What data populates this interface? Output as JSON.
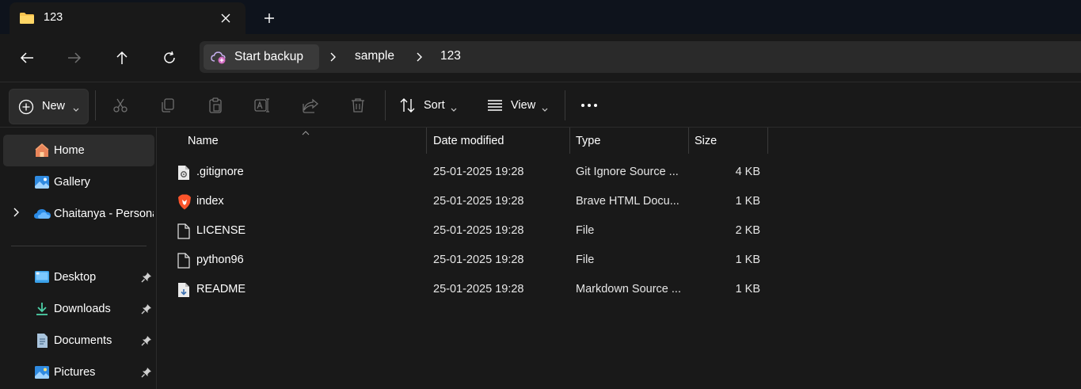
{
  "tab": {
    "title": "123",
    "icon": "folder-icon"
  },
  "address": {
    "backup_label": "Start backup",
    "breadcrumbs": [
      "sample",
      "123"
    ]
  },
  "commandbar": {
    "new_label": "New",
    "sort_label": "Sort",
    "view_label": "View"
  },
  "sidebar": {
    "items": [
      {
        "label": "Home",
        "icon": "home-icon"
      },
      {
        "label": "Gallery",
        "icon": "gallery-icon"
      },
      {
        "label": "Chaitanya - Personal",
        "icon": "onedrive-icon"
      },
      {
        "label": "Desktop",
        "icon": "desktop-icon"
      },
      {
        "label": "Downloads",
        "icon": "downloads-icon"
      },
      {
        "label": "Documents",
        "icon": "documents-icon"
      },
      {
        "label": "Pictures",
        "icon": "pictures-icon"
      }
    ]
  },
  "columns": {
    "name": "Name",
    "date": "Date modified",
    "type": "Type",
    "size": "Size"
  },
  "files": [
    {
      "name": ".gitignore",
      "date": "25-01-2025 19:28",
      "type": "Git Ignore Source ...",
      "size": "4 KB",
      "icon": "gear-file-icon"
    },
    {
      "name": "index",
      "date": "25-01-2025 19:28",
      "type": "Brave HTML Docu...",
      "size": "1 KB",
      "icon": "brave-icon"
    },
    {
      "name": "LICENSE",
      "date": "25-01-2025 19:28",
      "type": "File",
      "size": "2 KB",
      "icon": "file-icon"
    },
    {
      "name": "python96",
      "date": "25-01-2025 19:28",
      "type": "File",
      "size": "1 KB",
      "icon": "file-icon"
    },
    {
      "name": "README",
      "date": "25-01-2025 19:28",
      "type": "Markdown Source ...",
      "size": "1 KB",
      "icon": "markdown-file-icon"
    }
  ],
  "colors": {
    "accent": "#4cc2ff",
    "folder": "#f8c44f",
    "background": "#191919",
    "tabstrip": "#0e131c"
  }
}
